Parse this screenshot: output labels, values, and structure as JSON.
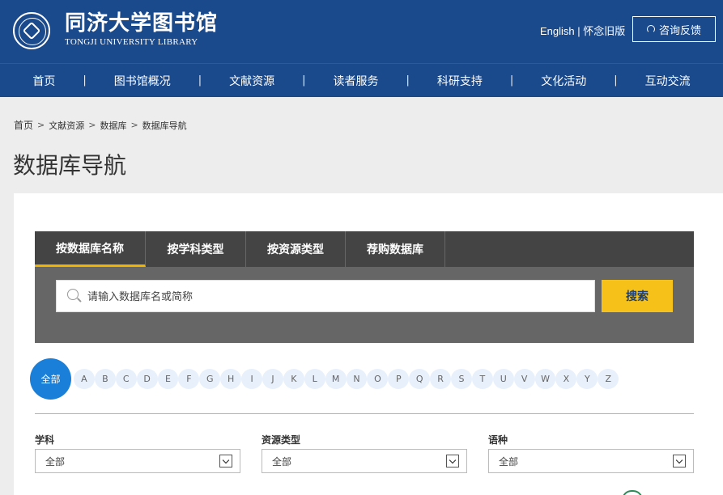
{
  "header": {
    "logo_cn": "同济大学图书馆",
    "logo_en": "TONGJI UNIVERSITY LIBRARY",
    "english": "English",
    "lang_sep": "|",
    "old_version": "怀念旧版",
    "consult": "咨询反馈"
  },
  "nav": {
    "items": [
      "首页",
      "图书馆概况",
      "文献资源",
      "读者服务",
      "科研支持",
      "文化活动",
      "互动交流"
    ]
  },
  "breadcrumb": {
    "home": "首页",
    "items": [
      "文献资源",
      "数据库",
      "数据库导航"
    ],
    "sep": ">"
  },
  "page_title": "数据库导航",
  "search": {
    "tabs": [
      "按数据库名称",
      "按学科类型",
      "按资源类型",
      "荐购数据库"
    ],
    "placeholder": "请输入数据库名或简称",
    "button": "搜索"
  },
  "letters": {
    "all": "全部",
    "items": [
      "A",
      "B",
      "C",
      "D",
      "E",
      "F",
      "G",
      "H",
      "I",
      "J",
      "K",
      "L",
      "M",
      "N",
      "O",
      "P",
      "Q",
      "R",
      "S",
      "T",
      "U",
      "V",
      "W",
      "X",
      "Y",
      "Z"
    ]
  },
  "filters": [
    {
      "label": "学科",
      "value": "全部"
    },
    {
      "label": "资源类型",
      "value": "全部"
    },
    {
      "label": "语种",
      "value": "全部"
    }
  ],
  "colors": {
    "header_bg": "#1b4a8c",
    "accent_yellow": "#f6c21a",
    "letter_active": "#1a7fd9"
  }
}
